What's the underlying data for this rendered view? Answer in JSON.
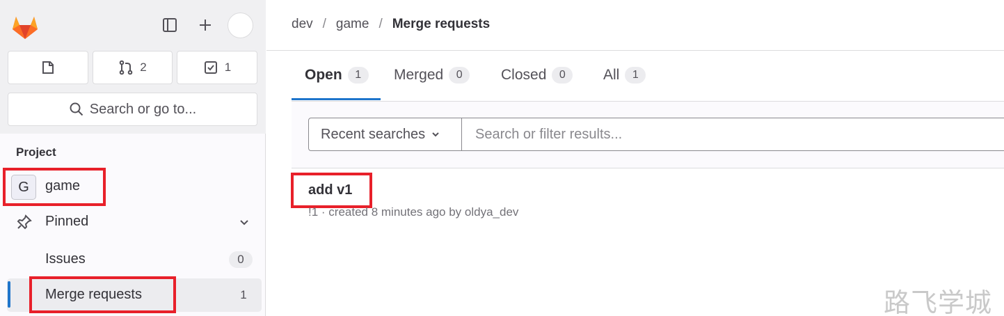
{
  "sidebar": {
    "counts": {
      "todo_icon": "todo-icon",
      "merge_requests": "2",
      "issues": "1"
    },
    "search_label": "Search or go to...",
    "section_label": "Project",
    "project": {
      "avatar_letter": "G",
      "name": "game"
    },
    "pinned_label": "Pinned",
    "items": [
      {
        "label": "Issues",
        "count": "0"
      },
      {
        "label": "Merge requests",
        "count": "1",
        "active": true
      }
    ]
  },
  "breadcrumb": [
    "dev",
    "game",
    "Merge requests"
  ],
  "tabs": [
    {
      "label": "Open",
      "count": "1",
      "active": true
    },
    {
      "label": "Merged",
      "count": "0"
    },
    {
      "label": "Closed",
      "count": "0"
    },
    {
      "label": "All",
      "count": "1"
    }
  ],
  "filter": {
    "recent_label": "Recent searches",
    "placeholder": "Search or filter results..."
  },
  "merge_requests": [
    {
      "title": "add v1",
      "meta": "!1 · created 8 minutes ago by oldya_dev"
    }
  ],
  "watermark": "路飞学城",
  "colors": {
    "accent": "#1f75cb",
    "highlight": "#e8202a"
  }
}
